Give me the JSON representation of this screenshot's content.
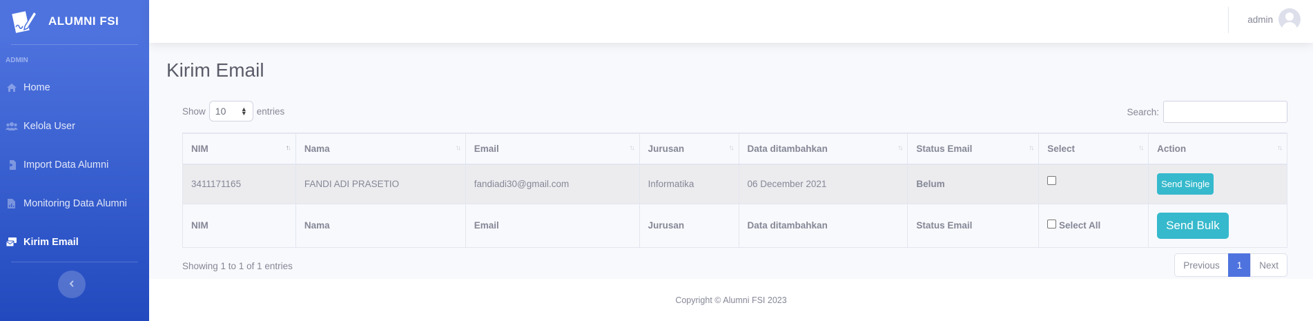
{
  "brand": {
    "name": "ALUMNI FSI",
    "icon": "pen-paper-icon"
  },
  "sidebar": {
    "heading": "ADMIN",
    "items": [
      {
        "label": "Home",
        "icon": "home-icon",
        "active": false
      },
      {
        "label": "Kelola User",
        "icon": "users-icon",
        "active": false
      },
      {
        "label": "Import Data Alumni",
        "icon": "file-import-icon",
        "active": false
      },
      {
        "label": "Monitoring Data Alumni",
        "icon": "file-chart-icon",
        "active": false
      },
      {
        "label": "Kirim Email",
        "icon": "mail-bulk-icon",
        "active": true
      }
    ],
    "toggle_icon": "chevron-left-icon"
  },
  "topbar": {
    "username": "admin"
  },
  "page": {
    "title": "Kirim Email"
  },
  "table_controls": {
    "show_label": "Show",
    "entries_value": "10",
    "entries_label": "entries",
    "search_label": "Search:",
    "search_value": ""
  },
  "table": {
    "columns": [
      "NIM",
      "Nama",
      "Email",
      "Jurusan",
      "Data ditambahkan",
      "Status Email",
      "Select",
      "Action"
    ],
    "rows": [
      {
        "nim": "3411171165",
        "nama": "FANDI ADI PRASETIO",
        "email": "fandiadi30@gmail.com",
        "jurusan": "Informatika",
        "ditambahkan": "06 December 2021",
        "status": "Belum",
        "action_label": "Send Single"
      }
    ],
    "footer": {
      "nim": "NIM",
      "nama": "Nama",
      "email": "Email",
      "jurusan": "Jurusan",
      "ditambahkan": "Data ditambahkan",
      "status": "Status Email",
      "select_all_label": "Select All",
      "bulk_label": "Send Bulk"
    }
  },
  "table_info": "Showing 1 to 1 of 1 entries",
  "pagination": {
    "previous": "Previous",
    "current": "1",
    "next": "Next"
  },
  "footer": {
    "copyright": "Copyright © Alumni FSI 2023"
  },
  "colors": {
    "primary": "#4e73df",
    "info": "#36b9cc",
    "sidebar_dark": "#224abe"
  }
}
